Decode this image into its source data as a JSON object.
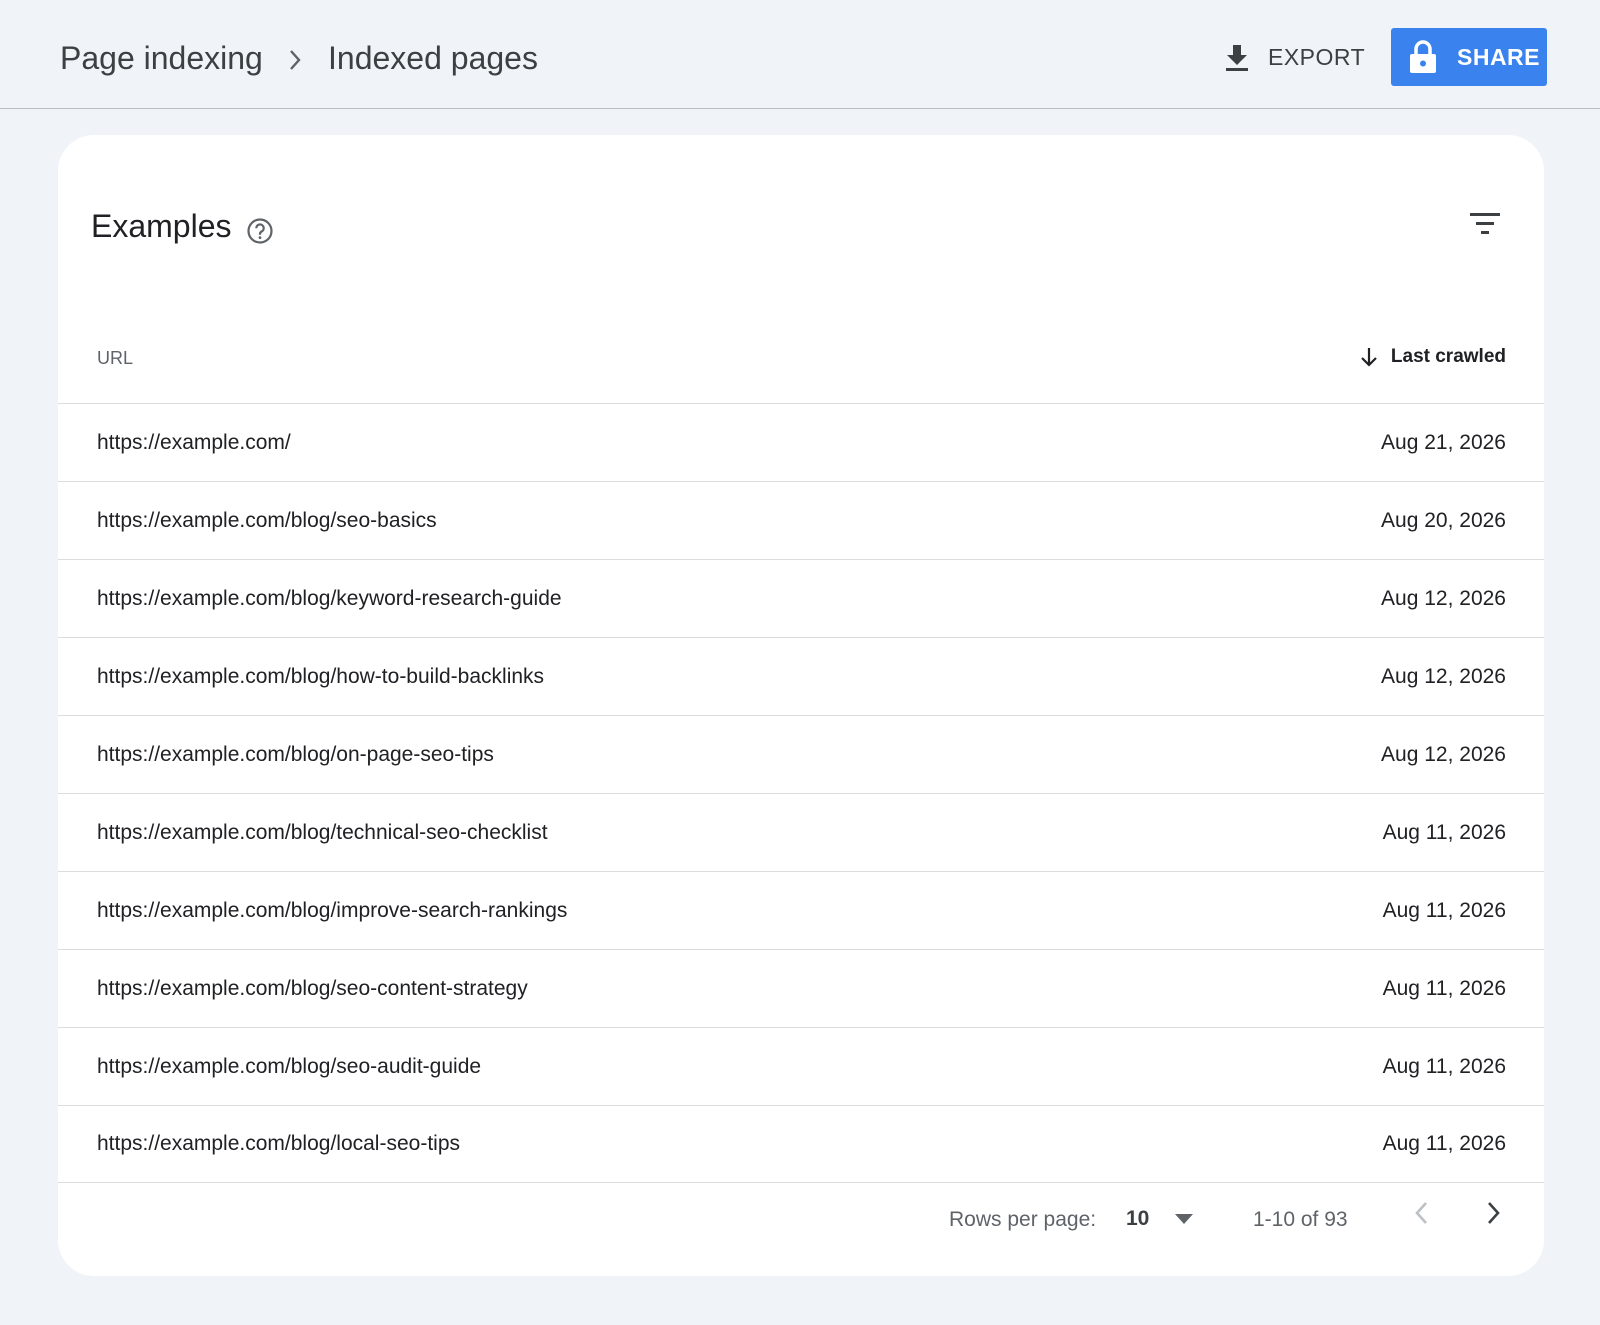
{
  "header": {
    "breadcrumb_root": "Page indexing",
    "title": "Indexed pages",
    "export_label": "EXPORT",
    "share_label": "SHARE",
    "accent_color": "#3a82ee"
  },
  "card": {
    "title": "Examples",
    "help_icon": "help-circle-icon",
    "filter_icon": "filter-icon"
  },
  "table": {
    "columns": {
      "url": "URL",
      "last_crawled": "Last crawled"
    },
    "sort": "descending",
    "rows": [
      {
        "url": "https://example.com/",
        "date": "Aug 21, 2026"
      },
      {
        "url": "https://example.com/blog/seo-basics",
        "date": "Aug 20, 2026"
      },
      {
        "url": "https://example.com/blog/keyword-research-guide",
        "date": "Aug 12, 2026"
      },
      {
        "url": "https://example.com/blog/how-to-build-backlinks",
        "date": "Aug 12, 2026"
      },
      {
        "url": "https://example.com/blog/on-page-seo-tips",
        "date": "Aug 12, 2026"
      },
      {
        "url": "https://example.com/blog/technical-seo-checklist",
        "date": "Aug 11, 2026"
      },
      {
        "url": "https://example.com/blog/improve-search-rankings",
        "date": "Aug 11, 2026"
      },
      {
        "url": "https://example.com/blog/seo-content-strategy",
        "date": "Aug 11, 2026"
      },
      {
        "url": "https://example.com/blog/seo-audit-guide",
        "date": "Aug 11, 2026"
      },
      {
        "url": "https://example.com/blog/local-seo-tips",
        "date": "Aug 11, 2026"
      }
    ]
  },
  "pagination": {
    "rows_per_page_label": "Rows per page:",
    "rows_per_page": "10",
    "range": "1-10 of 93"
  }
}
